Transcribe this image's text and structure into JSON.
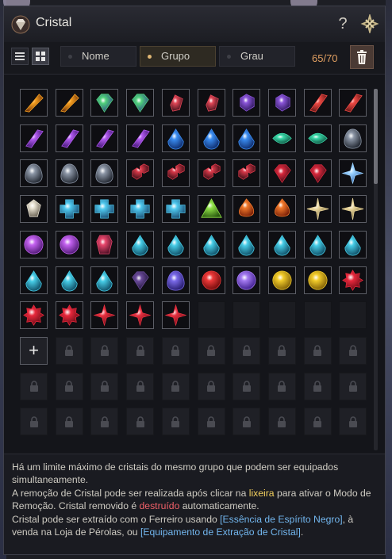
{
  "window": {
    "title": "Cristal",
    "help_glyph": "?",
    "title_icon": "crystal-emblem-icon",
    "close_icon": "close-icon"
  },
  "toolbar": {
    "view_list_icon": "list-view-icon",
    "view_grid_icon": "grid-view-icon",
    "sort_tabs": [
      {
        "label": "Nome",
        "selected": false
      },
      {
        "label": "Grupo",
        "selected": true
      },
      {
        "label": "Grau",
        "selected": false
      }
    ],
    "count": "65/70",
    "trash_icon": "trash-icon",
    "accent": "#e2a062"
  },
  "inventory": {
    "filled_count": 65,
    "empty_count": 5,
    "add_button": "+",
    "rows": [
      [
        "orange-dagger",
        "orange-dagger",
        "green-gem",
        "green-gem",
        "red-shard",
        "red-shard",
        "purple-hex",
        "purple-hex",
        "red-blade",
        "red-blade"
      ],
      [
        "purple-blade",
        "purple-blade",
        "purple-blade",
        "purple-blade",
        "blue-drop",
        "blue-drop",
        "blue-drop",
        "teal-eye",
        "teal-eye",
        "dark-egg"
      ],
      [
        "dark-egg",
        "dark-egg",
        "dark-egg",
        "red-cubes",
        "red-cubes",
        "red-cubes",
        "red-cubes",
        "ruby-gem",
        "ruby-gem",
        "blue-star"
      ],
      [
        "white-crystal",
        "teal-cross",
        "teal-cross",
        "teal-cross",
        "teal-cross",
        "green-tri",
        "orange-flame",
        "orange-flame",
        "gold-sparkle",
        "gold-sparkle"
      ],
      [
        "purple-round",
        "purple-round",
        "red-ingot",
        "aqua-drop",
        "aqua-drop",
        "aqua-drop",
        "aqua-drop",
        "aqua-drop",
        "aqua-drop",
        "aqua-drop"
      ],
      [
        "aqua-drop",
        "aqua-drop",
        "aqua-drop",
        "dark-purple",
        "indigo-egg",
        "red-round",
        "violet-round",
        "gold-round",
        "gold-round",
        "red-gear"
      ],
      [
        "red-gear",
        "red-gear",
        "red-star",
        "red-star",
        "red-star"
      ]
    ],
    "palette": {
      "orange-dagger": [
        "#f6a020",
        "#6a2e0a"
      ],
      "green-gem": [
        "#4fd17a",
        "#2d3f8a"
      ],
      "red-shard": [
        "#e04656",
        "#3a0e18"
      ],
      "purple-hex": [
        "#8a54d8",
        "#2a1656"
      ],
      "red-blade": [
        "#ee4a44",
        "#5a1212"
      ],
      "purple-blade": [
        "#b25af0",
        "#3e1470"
      ],
      "blue-drop": [
        "#3a8cf0",
        "#0e2a6a"
      ],
      "teal-eye": [
        "#3ad8a8",
        "#0c4a3a"
      ],
      "dark-egg": [
        "#8c96a6",
        "#1e232c"
      ],
      "red-cubes": [
        "#d83848",
        "#2a0a12"
      ],
      "ruby-gem": [
        "#d8283c",
        "#360a14"
      ],
      "blue-star": [
        "#9ad2ff",
        "#2a5aa8"
      ],
      "white-crystal": [
        "#e8e2d2",
        "#6a6254"
      ],
      "teal-cross": [
        "#4ec8ee",
        "#1a4a70"
      ],
      "green-tri": [
        "#8ee046",
        "#2a5a10"
      ],
      "orange-flame": [
        "#f0782a",
        "#7a2008"
      ],
      "gold-sparkle": [
        "#e8d49a",
        "#6a5a2a"
      ],
      "purple-round": [
        "#c462f0",
        "#4a1670"
      ],
      "red-ingot": [
        "#e8466c",
        "#4a0e24"
      ],
      "aqua-drop": [
        "#46cce6",
        "#0e4a62"
      ],
      "dark-purple": [
        "#6a4a9a",
        "#1a1230"
      ],
      "indigo-egg": [
        "#7a6ae8",
        "#241a6a"
      ],
      "red-round": [
        "#f03a3a",
        "#6a0a0a"
      ],
      "violet-round": [
        "#a47af0",
        "#3a1a8a"
      ],
      "gold-round": [
        "#f2cc2a",
        "#7a5a06"
      ],
      "red-gear": [
        "#e8283c",
        "#5a0812"
      ],
      "red-star": [
        "#e83040",
        "#600812"
      ]
    },
    "locked_icon": "lock-icon"
  },
  "info": {
    "line1": "Há um limite máximo de cristais do mesmo grupo que podem ser equipados simultaneamente.",
    "line2_a": "A remoção de Cristal pode ser realizada após clicar na ",
    "line2_hl": "lixeira",
    "line2_b": " para ativar o Modo de Remoção. Cristal removido é ",
    "line2_hl2": "destruído",
    "line2_c": " automaticamente.",
    "line3_a": "Cristal pode ser extraído com o Ferreiro usando ",
    "line3_hl": "[Essência de Espírito Negro]",
    "line3_b": ", à venda na Loja de Pérolas, ou ",
    "line3_hl2": "[Equipamento de Extração de Cristal]",
    "line3_c": "."
  }
}
